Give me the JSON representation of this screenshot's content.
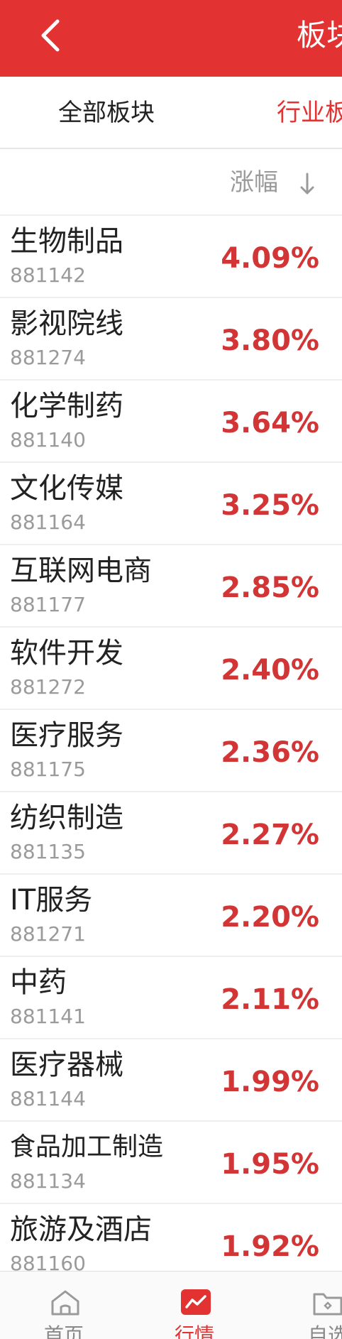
{
  "header": {
    "title": "板块",
    "back_icon": "chevron-left-icon",
    "background_color": "#e23232"
  },
  "tabs": [
    {
      "label": "全部板块",
      "active": false
    },
    {
      "label": "行业板",
      "active": true
    }
  ],
  "column_header": {
    "label": "涨幅",
    "sort_icon": "arrow-down-icon"
  },
  "sectors": [
    {
      "name": "生物制品",
      "code": "881142",
      "change": "4.09%"
    },
    {
      "name": "影视院线",
      "code": "881274",
      "change": "3.80%"
    },
    {
      "name": "化学制药",
      "code": "881140",
      "change": "3.64%"
    },
    {
      "name": "文化传媒",
      "code": "881164",
      "change": "3.25%"
    },
    {
      "name": "互联网电商",
      "code": "881177",
      "change": "2.85%"
    },
    {
      "name": "软件开发",
      "code": "881272",
      "change": "2.40%"
    },
    {
      "name": "医疗服务",
      "code": "881175",
      "change": "2.36%"
    },
    {
      "name": "纺织制造",
      "code": "881135",
      "change": "2.27%"
    },
    {
      "name": "IT服务",
      "code": "881271",
      "change": "2.20%"
    },
    {
      "name": "中药",
      "code": "881141",
      "change": "2.11%"
    },
    {
      "name": "医疗器械",
      "code": "881144",
      "change": "1.99%"
    },
    {
      "name": "食品加工制造",
      "code": "881134",
      "change": "1.95%"
    },
    {
      "name": "旅游及酒店",
      "code": "881160",
      "change": "1.92%"
    }
  ],
  "bottom_nav": [
    {
      "label": "首页",
      "icon": "home-icon",
      "active": false
    },
    {
      "label": "行情",
      "icon": "market-chart-icon",
      "active": true
    },
    {
      "label": "自选",
      "icon": "folder-icon",
      "active": false
    }
  ],
  "colors": {
    "accent": "#e23232",
    "positive_change": "#d23535",
    "secondary_text": "#9a9a9a"
  }
}
